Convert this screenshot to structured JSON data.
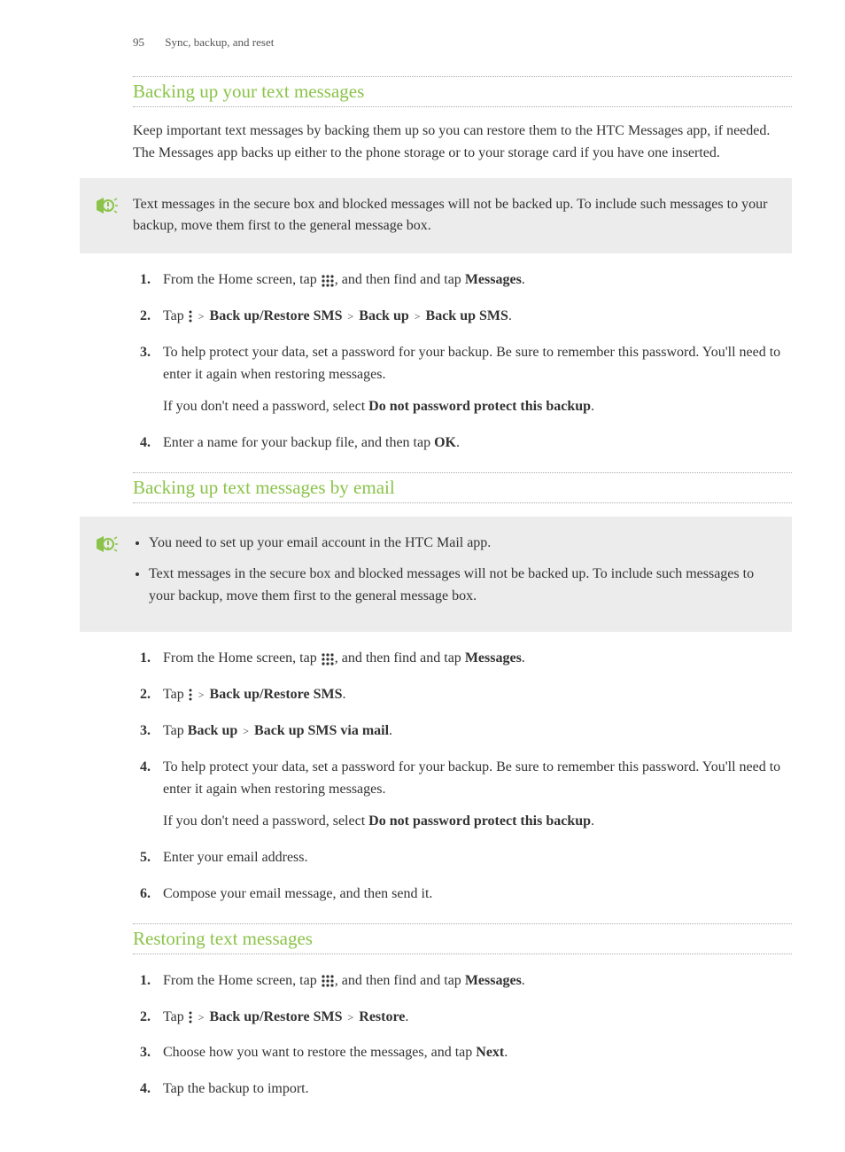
{
  "header": {
    "page_num": "95",
    "section": "Sync, backup, and reset"
  },
  "s1": {
    "heading": "Backing up your text messages",
    "intro": "Keep important text messages by backing them up so you can restore them to the HTC Messages app, if needed. The Messages app backs up either to the phone storage or to your storage card if you have one inserted.",
    "note": "Text messages in the secure box and blocked messages will not be backed up. To include such messages to your backup, move them first to the general message box.",
    "step1_a": "From the Home screen, tap ",
    "step1_b": ", and then find and tap ",
    "step1_c": "Messages",
    "step1_d": ".",
    "step2_a": "Tap ",
    "step2_b": "Back up/Restore SMS",
    "step2_c": "Back up",
    "step2_d": "Back up SMS",
    "step2_e": ".",
    "step3": "To help protect your data, set a password for your backup. Be sure to remember this password. You'll need to enter it again when restoring messages.",
    "step3_sub_a": "If you don't need a password, select ",
    "step3_sub_b": "Do not password protect this backup",
    "step3_sub_c": ".",
    "step4_a": "Enter a name for your backup file, and then tap ",
    "step4_b": "OK",
    "step4_c": "."
  },
  "s2": {
    "heading": "Backing up text messages by email",
    "note_b1": "You need to set up your email account in the HTC Mail app.",
    "note_b2": "Text messages in the secure box and blocked messages will not be backed up. To include such messages to your backup, move them first to the general message box.",
    "step1_a": "From the Home screen, tap ",
    "step1_b": ", and then find and tap ",
    "step1_c": "Messages",
    "step1_d": ".",
    "step2_a": "Tap ",
    "step2_b": "Back up/Restore SMS",
    "step2_c": ".",
    "step3_a": "Tap ",
    "step3_b": "Back up",
    "step3_c": "Back up SMS via mail",
    "step3_d": ".",
    "step4": "To help protect your data, set a password for your backup. Be sure to remember this password. You'll need to enter it again when restoring messages.",
    "step4_sub_a": "If you don't need a password, select ",
    "step4_sub_b": "Do not password protect this backup",
    "step4_sub_c": ".",
    "step5": "Enter your email address.",
    "step6": "Compose your email message, and then send it."
  },
  "s3": {
    "heading": "Restoring text messages",
    "step1_a": "From the Home screen, tap ",
    "step1_b": ", and then find and tap ",
    "step1_c": "Messages",
    "step1_d": ".",
    "step2_a": "Tap ",
    "step2_b": "Back up/Restore SMS",
    "step2_c": "Restore",
    "step2_d": ".",
    "step3_a": "Choose how you want to restore the messages, and tap ",
    "step3_b": "Next",
    "step3_c": ".",
    "step4": "Tap the backup to import."
  },
  "glyphs": {
    "chevron": ">"
  }
}
